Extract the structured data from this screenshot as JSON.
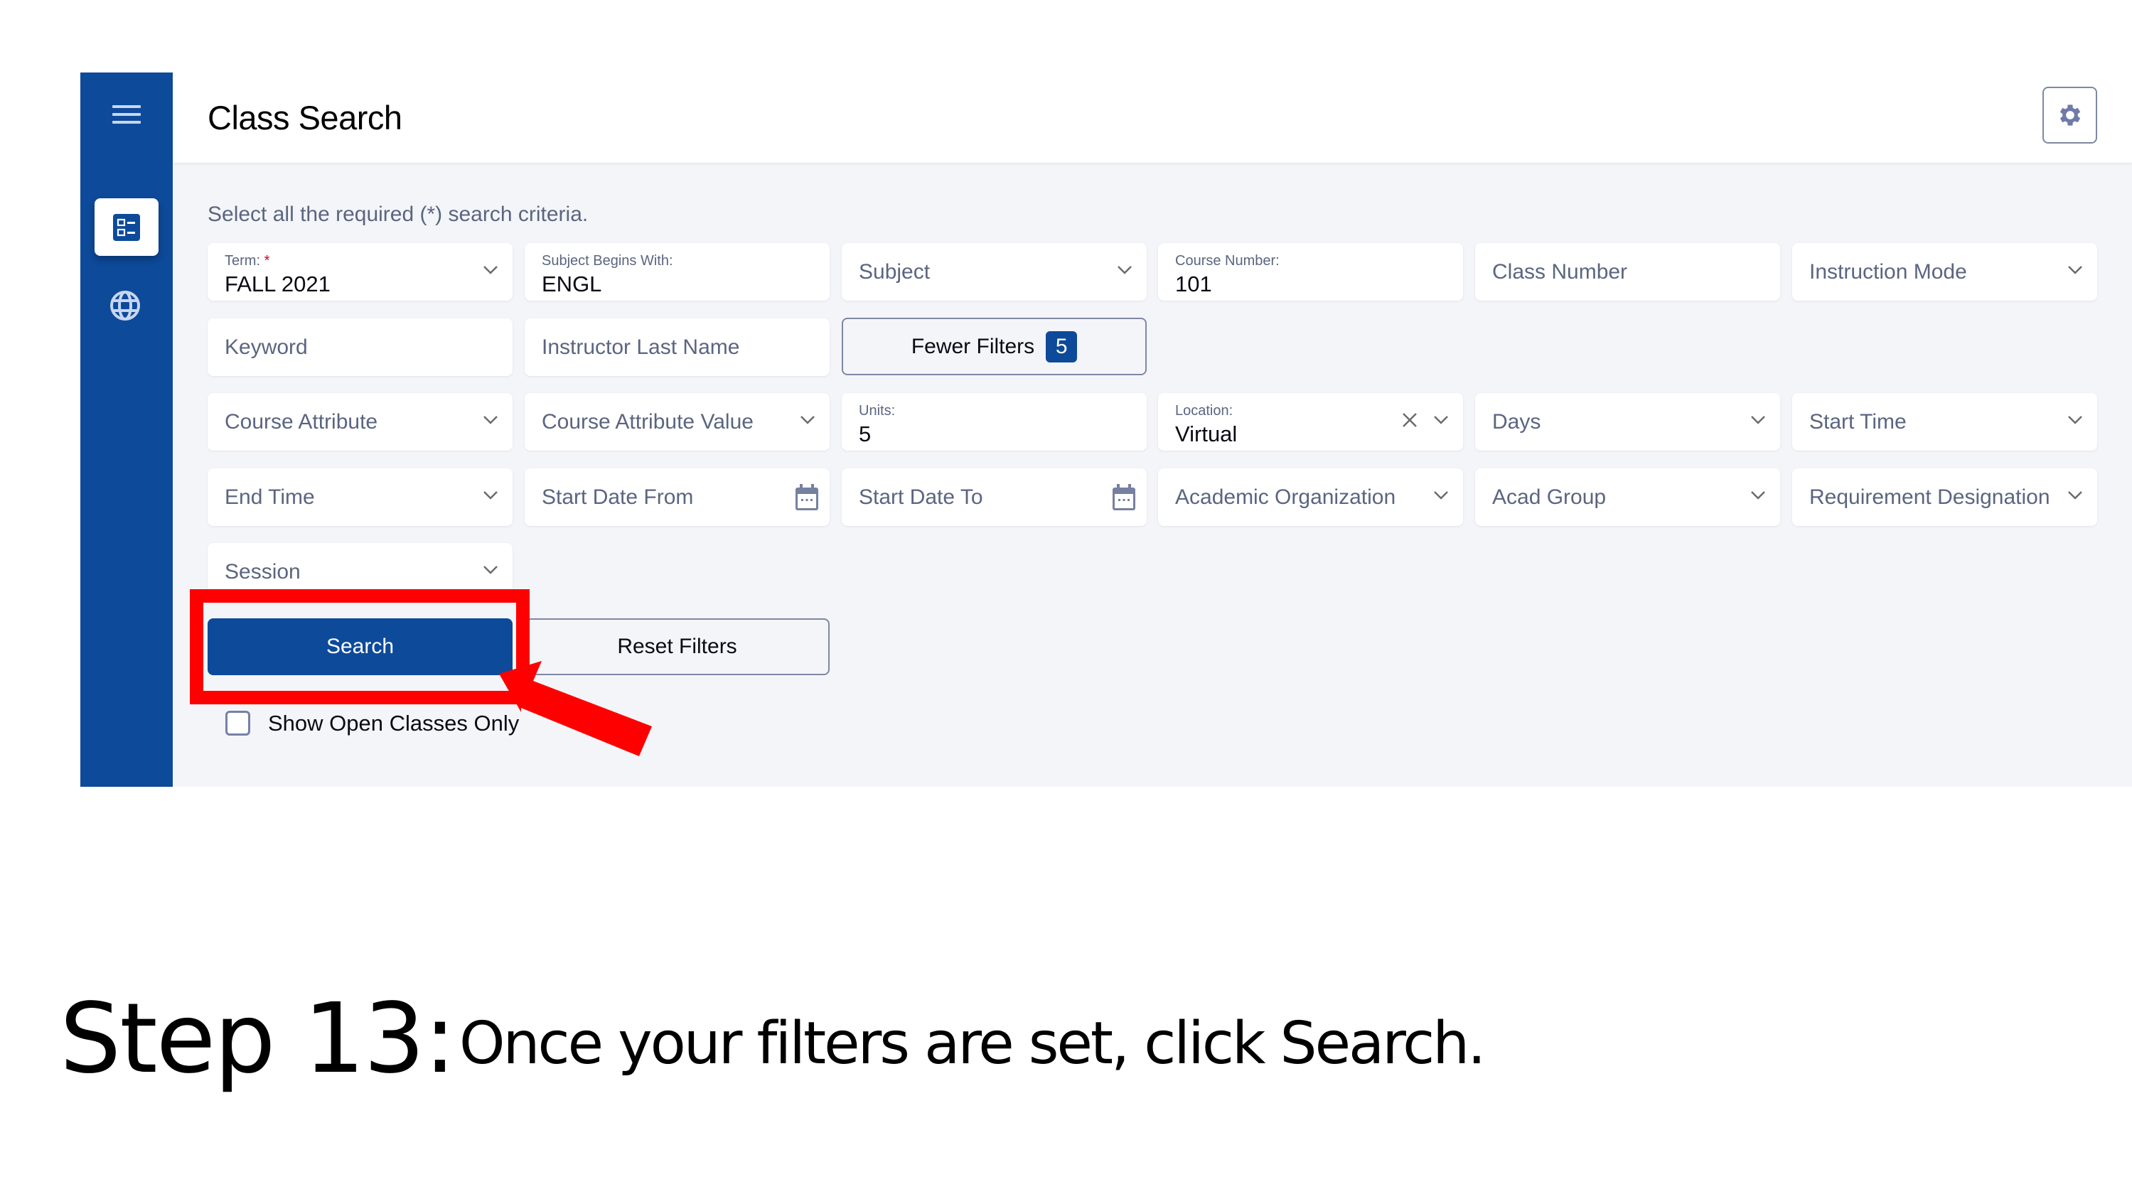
{
  "header": {
    "title": "Class Search",
    "settings_icon": "gear-icon"
  },
  "sidebar": {
    "menu_icon": "hamburger-menu-icon",
    "items": [
      {
        "icon": "class-search-list-icon",
        "active": true
      },
      {
        "icon": "globe-icon",
        "active": false
      }
    ]
  },
  "instructions": "Select all the required (*) search criteria.",
  "fields": {
    "term": {
      "label": "Term:",
      "required_mark": "*",
      "value": "FALL 2021"
    },
    "subject_begins": {
      "label": "Subject Begins With:",
      "value": "ENGL"
    },
    "subject": {
      "placeholder": "Subject"
    },
    "course_number": {
      "label": "Course Number:",
      "value": "101"
    },
    "class_number": {
      "placeholder": "Class Number"
    },
    "instruction_mode": {
      "placeholder": "Instruction Mode"
    },
    "keyword": {
      "placeholder": "Keyword"
    },
    "instructor_last_name": {
      "placeholder": "Instructor Last Name"
    },
    "course_attribute": {
      "placeholder": "Course Attribute"
    },
    "course_attribute_value": {
      "placeholder": "Course Attribute Value"
    },
    "units": {
      "label": "Units:",
      "value": "5"
    },
    "location": {
      "label": "Location:",
      "value": "Virtual"
    },
    "days": {
      "placeholder": "Days"
    },
    "start_time": {
      "placeholder": "Start Time"
    },
    "end_time": {
      "placeholder": "End Time"
    },
    "start_date_from": {
      "placeholder": "Start Date From"
    },
    "start_date_to": {
      "placeholder": "Start Date To"
    },
    "academic_organization": {
      "placeholder": "Academic Organization"
    },
    "acad_group": {
      "placeholder": "Acad Group"
    },
    "requirement_designation": {
      "placeholder": "Requirement Designation"
    },
    "session": {
      "placeholder": "Session"
    }
  },
  "buttons": {
    "fewer_filters": {
      "label": "Fewer Filters",
      "count": "5"
    },
    "search": "Search",
    "reset_filters": "Reset Filters"
  },
  "show_open_classes": {
    "label": "Show Open Classes Only",
    "checked": false
  },
  "annotation": {
    "step": "Step 13:",
    "caption_prefix": "Once your filters are set, click ",
    "caption_bold": "Search",
    "caption_suffix": ".",
    "highlight_color": "#ff0000"
  },
  "colors": {
    "brand": "#0d4a9a",
    "background": "#f4f5f9",
    "placeholder_text": "#5b6580",
    "required": "#d0021b"
  }
}
